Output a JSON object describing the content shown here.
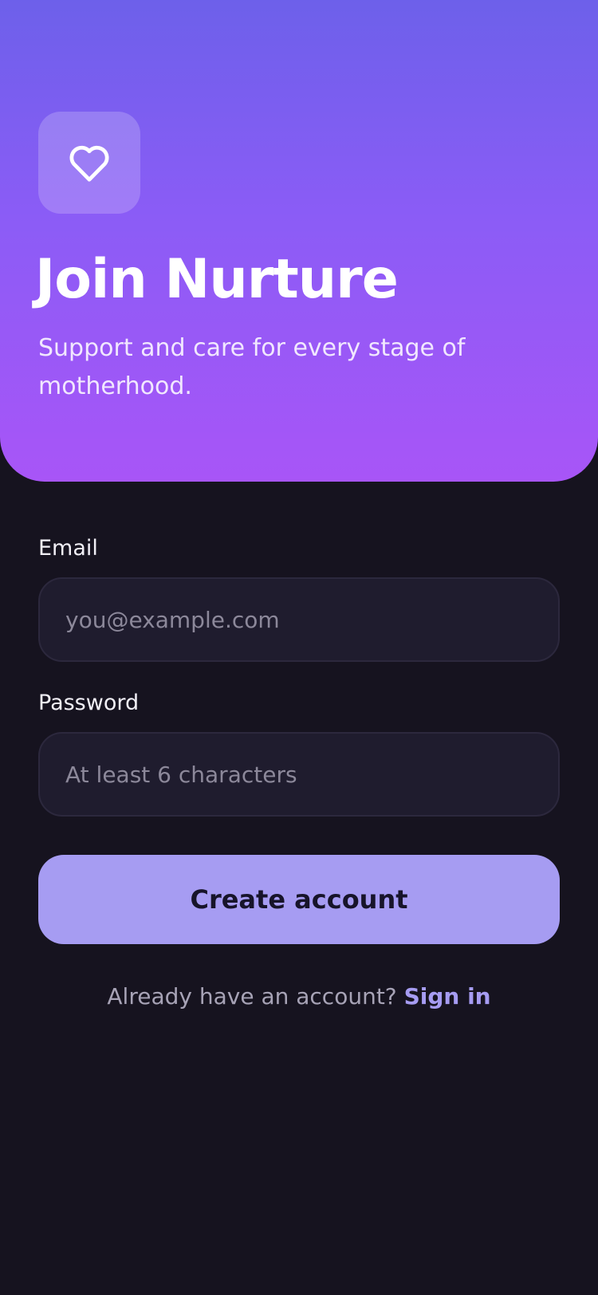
{
  "hero": {
    "title": "Join Nurture",
    "subtitle": "Support and care for every stage of motherhood.",
    "logo_icon": "heart-icon"
  },
  "form": {
    "email": {
      "label": "Email",
      "placeholder": "you@example.com",
      "value": ""
    },
    "password": {
      "label": "Password",
      "placeholder": "At least 6 characters",
      "value": ""
    },
    "submit_label": "Create account"
  },
  "footer": {
    "prompt": "Already have an account?",
    "link_label": "Sign in"
  },
  "colors": {
    "gradient_top": "#6d60ea",
    "gradient_bottom": "#a855f7",
    "background": "#16131f",
    "input_background": "#1f1c2e",
    "accent": "#a69cf2"
  }
}
